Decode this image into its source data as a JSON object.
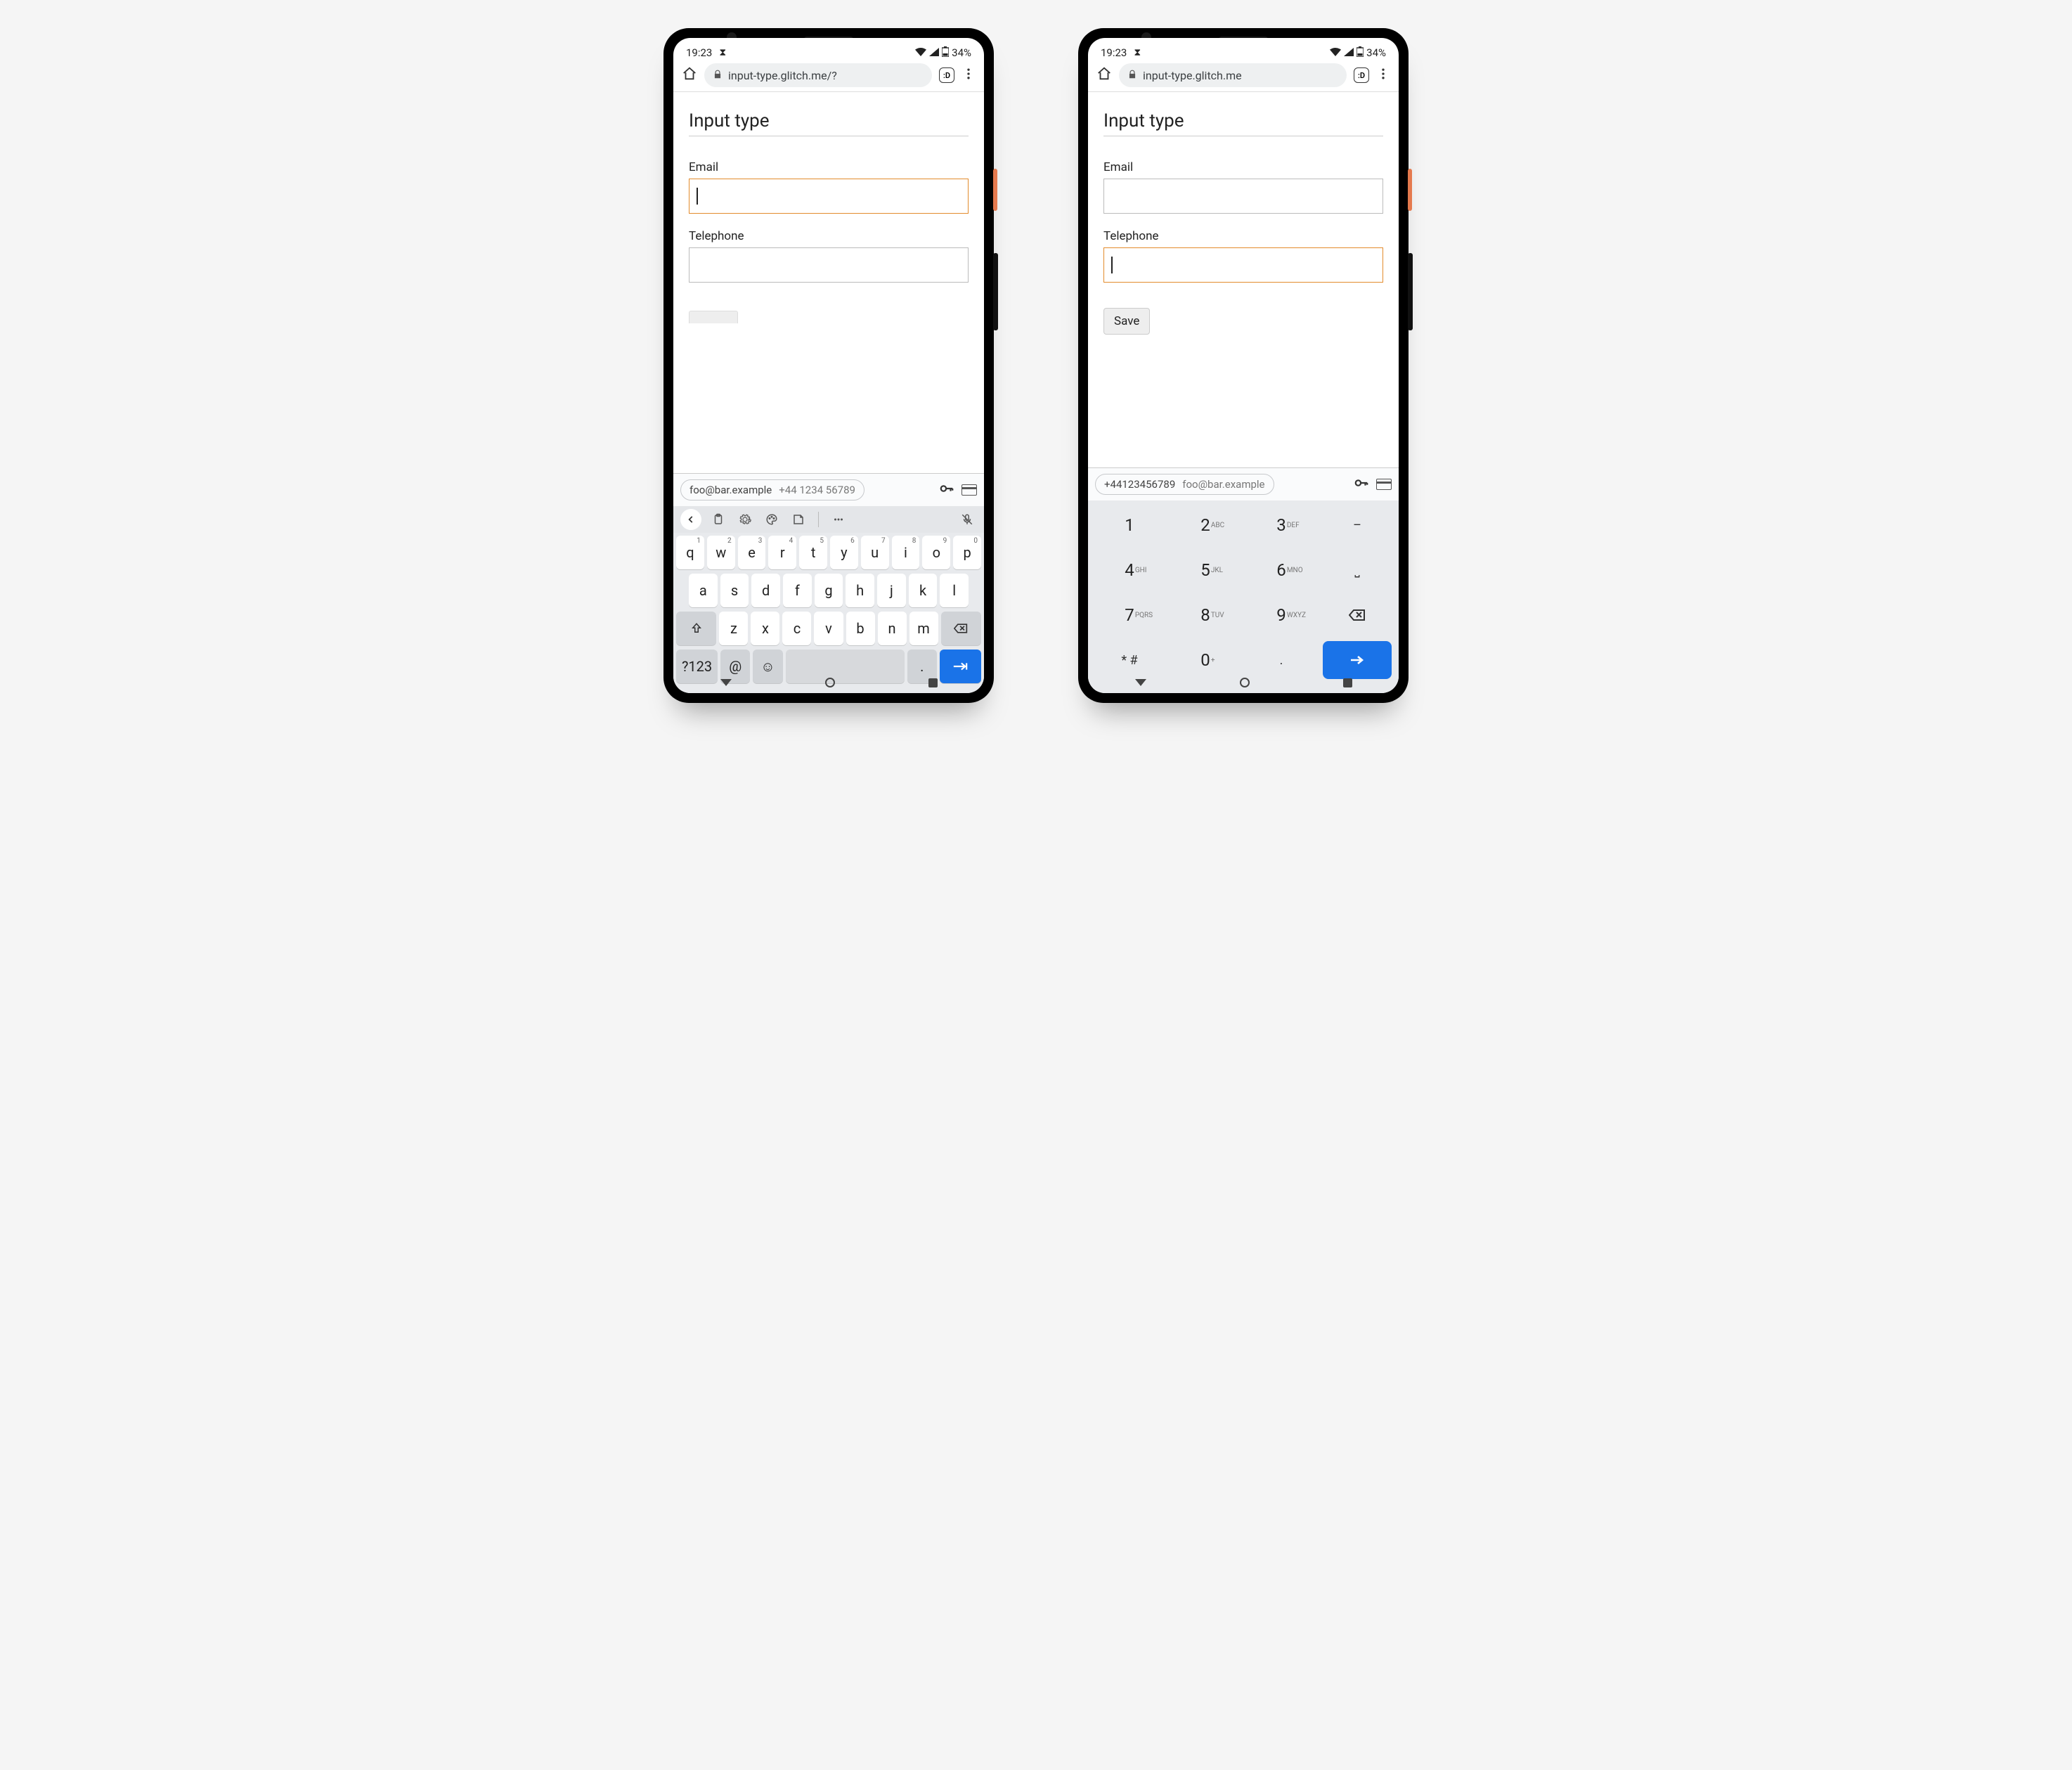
{
  "status": {
    "time": "19:23",
    "battery": "34%"
  },
  "browser": {
    "url_left": "input-type.glitch.me/?",
    "url_right": "input-type.glitch.me",
    "dino_badge": ":D"
  },
  "page": {
    "heading": "Input type",
    "email_label": "Email",
    "tel_label": "Telephone",
    "save_label": "Save"
  },
  "autofill": {
    "email": "foo@bar.example",
    "phone_spaced": "+44 1234 56789",
    "phone": "+44123456789"
  },
  "qwerty": {
    "row1": [
      "q",
      "w",
      "e",
      "r",
      "t",
      "y",
      "u",
      "i",
      "o",
      "p"
    ],
    "row1n": [
      "1",
      "2",
      "3",
      "4",
      "5",
      "6",
      "7",
      "8",
      "9",
      "0"
    ],
    "row2": [
      "a",
      "s",
      "d",
      "f",
      "g",
      "h",
      "j",
      "k",
      "l"
    ],
    "row3": [
      "z",
      "x",
      "c",
      "v",
      "b",
      "n",
      "m"
    ],
    "sym": "?123",
    "at": "@",
    "dot": "."
  },
  "numpad": {
    "keys": [
      [
        "1",
        ""
      ],
      [
        "2",
        "ABC"
      ],
      [
        "3",
        "DEF"
      ],
      [
        "4",
        "GHI"
      ],
      [
        "5",
        "JKL"
      ],
      [
        "6",
        "MNO"
      ],
      [
        "7",
        "PQRS"
      ],
      [
        "8",
        "TUV"
      ],
      [
        "9",
        "WXYZ"
      ]
    ],
    "star": "* #",
    "zero": "0",
    "plus": "+",
    "dot": "."
  }
}
